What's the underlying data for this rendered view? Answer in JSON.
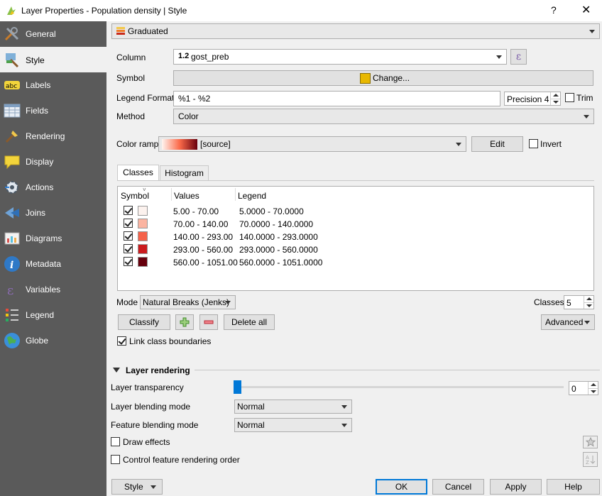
{
  "window": {
    "title": "Layer Properties - Population density | Style",
    "help": "?",
    "close": "✕"
  },
  "sidebar": {
    "items": [
      {
        "label": "General",
        "icon": "tools-icon"
      },
      {
        "label": "Style",
        "icon": "paintbrush-icon"
      },
      {
        "label": "Labels",
        "icon": "abc-label-icon"
      },
      {
        "label": "Fields",
        "icon": "table-icon"
      },
      {
        "label": "Rendering",
        "icon": "brush-icon"
      },
      {
        "label": "Display",
        "icon": "speech-bubble-icon"
      },
      {
        "label": "Actions",
        "icon": "gear-icon"
      },
      {
        "label": "Joins",
        "icon": "join-icon"
      },
      {
        "label": "Diagrams",
        "icon": "diagram-icon"
      },
      {
        "label": "Metadata",
        "icon": "info-icon"
      },
      {
        "label": "Variables",
        "icon": "epsilon-icon"
      },
      {
        "label": "Legend",
        "icon": "legend-icon"
      },
      {
        "label": "Globe",
        "icon": "globe-icon"
      }
    ],
    "active_index": 1
  },
  "renderer": {
    "value": "Graduated"
  },
  "form": {
    "column_label": "Column",
    "column_type": "1.2",
    "column_value": "gost_preb",
    "expression_symbol": "ε",
    "symbol_label": "Symbol",
    "symbol_button": "Change...",
    "symbol_color": "#e8b800",
    "legend_format_label": "Legend Format",
    "legend_format_value": "%1 - %2",
    "precision_label": "Precision 4",
    "trim_label": "Trim",
    "method_label": "Method",
    "method_value": "Color",
    "color_ramp_label": "Color ramp",
    "color_ramp_value": "[source]",
    "edit_button": "Edit",
    "invert_label": "Invert"
  },
  "tabs": [
    {
      "label": "Classes",
      "active": true
    },
    {
      "label": "Histogram",
      "active": false
    }
  ],
  "classes_table": {
    "headers": [
      "Symbol",
      "Values",
      "Legend"
    ],
    "rows": [
      {
        "color": "#fcf2ee",
        "values": "5.00 - 70.00",
        "legend": "5.0000 - 70.0000",
        "checked": true
      },
      {
        "color": "#fbb4a1",
        "values": "70.00 - 140.00",
        "legend": "70.0000 - 140.0000",
        "checked": true
      },
      {
        "color": "#f5624a",
        "values": "140.00 - 293.00",
        "legend": "140.0000 - 293.0000",
        "checked": true
      },
      {
        "color": "#cb1b1e",
        "values": "293.00 - 560.00",
        "legend": "293.0000 - 560.0000",
        "checked": true
      },
      {
        "color": "#67000d",
        "values": "560.00 - 1051.00",
        "legend": "560.0000 - 1051.0000",
        "checked": true
      }
    ]
  },
  "mode": {
    "label": "Mode",
    "value": "Natural Breaks (Jenks)",
    "classes_label": "Classes",
    "classes_value": "5"
  },
  "actions": {
    "classify": "Classify",
    "add_icon": "plus-icon",
    "remove_icon": "minus-icon",
    "delete_all": "Delete all",
    "advanced": "Advanced",
    "link_boundaries": "Link class boundaries"
  },
  "layer_rendering": {
    "header": "Layer rendering",
    "transparency_label": "Layer transparency",
    "transparency_value": "0",
    "blending_label": "Layer blending mode",
    "blending_value": "Normal",
    "feature_blending_label": "Feature blending mode",
    "feature_blending_value": "Normal",
    "draw_effects_label": "Draw effects",
    "control_order_label": "Control feature rendering order"
  },
  "footer": {
    "style": "Style",
    "ok": "OK",
    "cancel": "Cancel",
    "apply": "Apply",
    "help": "Help"
  },
  "colors": {
    "accent": "#0078d7",
    "sidebar_bg": "#5a5a5a"
  }
}
